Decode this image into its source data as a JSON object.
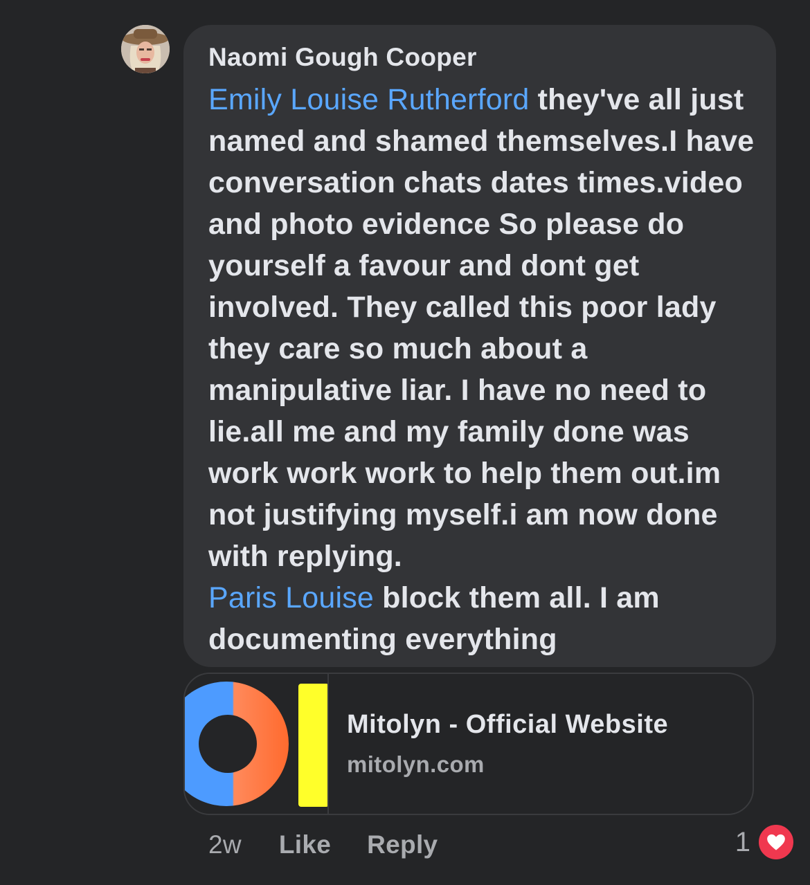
{
  "comment": {
    "author": "Naomi Gough Cooper",
    "mention_1": "Emily Louise Rutherford",
    "text_1": " they've all just named and shamed themselves.I have conversation chats dates times.video and photo evidence So please do yourself a favour and dont get involved. They called this poor lady they care so much about a manipulative liar. I have no need to lie.all me and my family done was work work work to help them out.im not justifying myself.i am now done with replying.",
    "mention_2": "Paris Louise",
    "text_2": " block them all. I am documenting everything"
  },
  "link_card": {
    "title": "Mitolyn - Official Website",
    "domain": "mitolyn.com"
  },
  "actions": {
    "time": "2w",
    "like_label": "Like",
    "reply_label": "Reply"
  },
  "reactions": {
    "count": "1",
    "icon": "heart-icon",
    "color": "#f0384f"
  },
  "colors": {
    "background": "#242527",
    "bubble": "#333437",
    "mention": "#5aa7ff",
    "text": "#e4e6eb",
    "muted": "#a9abaf"
  }
}
